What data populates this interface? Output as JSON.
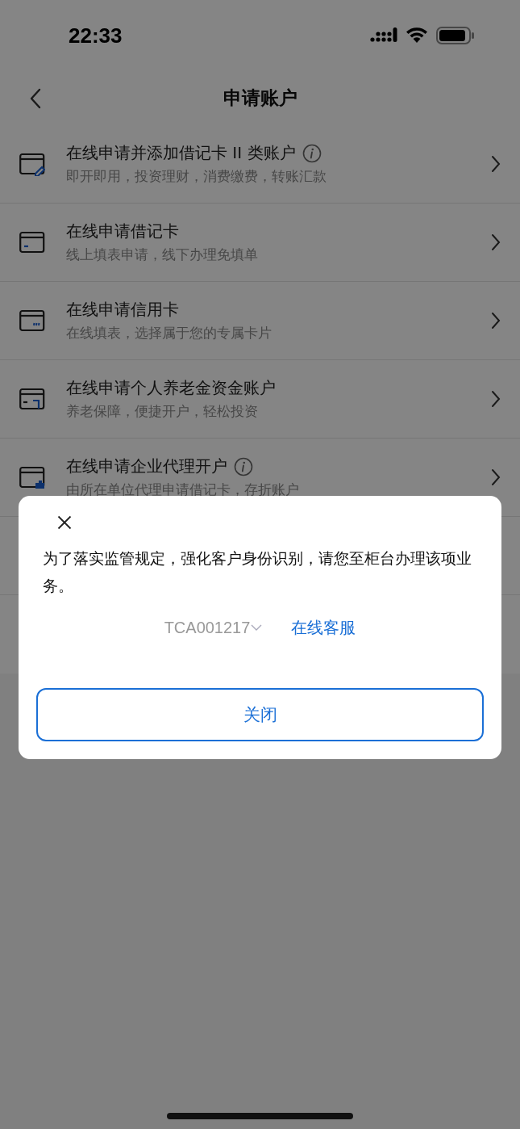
{
  "status_bar": {
    "time": "22:33"
  },
  "nav": {
    "title": "申请账户"
  },
  "items": [
    {
      "kind": "edit",
      "title": "在线申请并添加借记卡 II 类账户",
      "info": true,
      "subtitle": "即开即用，投资理财，消费缴费，转账汇款"
    },
    {
      "kind": "debit",
      "title": "在线申请借记卡",
      "info": false,
      "subtitle": "线上填表申请，线下办理免填单"
    },
    {
      "kind": "credit",
      "title": "在线申请信用卡",
      "info": false,
      "subtitle": "在线填表，选择属于您的专属卡片"
    },
    {
      "kind": "pension",
      "title": "在线申请个人养老金资金账户",
      "info": false,
      "subtitle": "养老保障，便捷开户，轻松投资"
    },
    {
      "kind": "agent",
      "title": "在线申请企业代理开户",
      "info": true,
      "subtitle": "由所在单位代理申请借记卡，存折账户"
    }
  ],
  "dialog": {
    "message": "为了落实监管规定，强化客户身份识别，请您至柜台办理该项业务。",
    "code": "TCA001217",
    "link": "在线客服",
    "button": "关闭"
  }
}
